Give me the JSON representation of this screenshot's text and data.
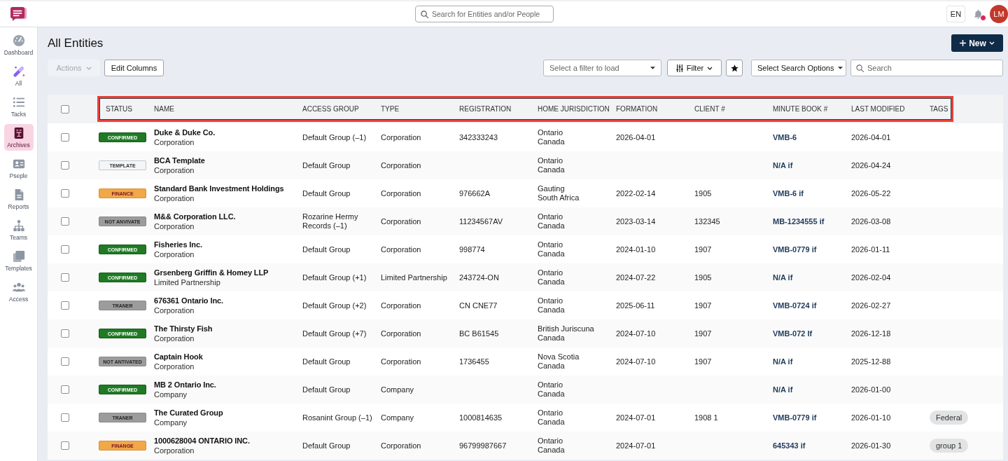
{
  "topbar": {
    "search": {
      "placeholder": "Search for Entities and/or People"
    },
    "language": "EN",
    "notifications": {
      "unread": true
    },
    "avatar": {
      "initials": "LM"
    }
  },
  "sidebar": {
    "items": [
      {
        "label": "Dashboard",
        "kind": "dashboard",
        "selected": false
      },
      {
        "label": "All",
        "kind": "all",
        "selected": false
      },
      {
        "label": "Tacks",
        "kind": "tasks",
        "selected": false
      },
      {
        "label": "Archives",
        "kind": "archives",
        "selected": true
      },
      {
        "label": "Pseple",
        "kind": "people",
        "selected": false
      },
      {
        "label": "Reports",
        "kind": "reports",
        "selected": false
      },
      {
        "label": "Teams",
        "kind": "teams",
        "selected": false
      },
      {
        "label": "Templates",
        "kind": "templates",
        "selected": false
      },
      {
        "label": "Access",
        "kind": "access",
        "selected": false
      }
    ]
  },
  "page": {
    "title": "All Entities",
    "new_button": {
      "label": "New"
    }
  },
  "toolbar": {
    "actions": {
      "label": "Actions",
      "disabled": true
    },
    "edit_columns": {
      "label": "Edit Columns"
    },
    "filter_select": {
      "placeholder": "Select a filter to load"
    },
    "filter_button": {
      "label": "Filter"
    },
    "search_options": {
      "label": "Select Search Options"
    },
    "search": {
      "placeholder": "Search"
    }
  },
  "table": {
    "header_highlighted": true,
    "header_checked": false,
    "columns": [
      "STATUS",
      "NAME",
      "ACCESS GROUP",
      "TYPE",
      "REGISTRATION",
      "HOME JURISDICTION",
      "FORMATION",
      "CLIENT #",
      "MINUTE BOOK #",
      "LAST MODIFIED",
      "TAGS"
    ],
    "rows": [
      {
        "checked": false,
        "status": {
          "label": "CONFIRMED",
          "kind": "confirmed"
        },
        "name": "Duke & Duke Co.",
        "entity_type": "Corporation",
        "access_group": "Default Group (–1)",
        "type": "Corporation",
        "registration": "342333243",
        "jurisdiction": {
          "region": "Ontario",
          "country": "Canada"
        },
        "formation": "2026-04-01",
        "minute_book": "VMB-6",
        "last_modified": "2026-04-01"
      },
      {
        "checked": false,
        "status": {
          "label": "TEMPLATE",
          "kind": "template"
        },
        "name": "BCA Template",
        "entity_type": "Corporation",
        "access_group": "Default Group",
        "type": "Corporation",
        "jurisdiction": {
          "region": "Ontario",
          "country": "Canada"
        },
        "minute_book": "N/A if",
        "last_modified": "2026-04-24"
      },
      {
        "checked": false,
        "status": {
          "label": "FINANCE",
          "kind": "finance"
        },
        "name": "Standard Bank Investment Holdings",
        "entity_type": "Corporation",
        "access_group": "Default Group",
        "type": "Corporation",
        "registration": "976662A",
        "jurisdiction": {
          "region": "Gauting",
          "country": "South Africa"
        },
        "formation": "2022-02-14",
        "client": "1905",
        "minute_book": "VMB-6 if",
        "last_modified": "2026-05-22"
      },
      {
        "checked": false,
        "status": {
          "label": "NOT ANVIVATE",
          "kind": "inactive"
        },
        "name": "M&& Corporation LLC.",
        "entity_type": "Corporation",
        "access_group": "Rozarine Hermy Records (–1)",
        "type": "Corporation",
        "registration": "11234567AV",
        "jurisdiction": {
          "region": "Ontario",
          "country": "Canada"
        },
        "formation": "2023-03-14",
        "client": "132345",
        "minute_book": "MB-1234555 if",
        "last_modified": "2026-03-08"
      },
      {
        "checked": false,
        "status": {
          "label": "CONFIRMED",
          "kind": "confirmed"
        },
        "name": "Fisheries Inc.",
        "entity_type": "Corporation",
        "access_group": "Default Group",
        "type": "Corporation",
        "registration": "998774",
        "jurisdiction": {
          "region": "Ontario",
          "country": "Canada"
        },
        "formation": "2024-01-10",
        "client": "1907",
        "minute_book": "VMB-0779 if",
        "last_modified": "2026-01-11"
      },
      {
        "checked": false,
        "status": {
          "label": "CONFIRMED",
          "kind": "confirmed"
        },
        "name": "Grsenberg Griffin & Homey LLP",
        "entity_type": "Limited Partnership",
        "access_group": "Default Group (+1)",
        "type": "Limited Partnership",
        "registration": "243724-ON",
        "jurisdiction": {
          "region": "Ontario",
          "country": "Canada"
        },
        "formation": "2024-07-22",
        "client": "1905",
        "minute_book": "N/A if",
        "last_modified": "2026-02-04"
      },
      {
        "checked": false,
        "status": {
          "label": "TRANER",
          "kind": "inactive"
        },
        "name": "676361 Ontario Inc.",
        "entity_type": "Corporation",
        "access_group": "Default Group (+2)",
        "type": "Corporation",
        "registration": "CN CNE77",
        "jurisdiction": {
          "region": "Ontario",
          "country": "Canada"
        },
        "formation": "2025-06-11",
        "client": "1907",
        "minute_book": "VMB-0724 if",
        "last_modified": "2026-02-27"
      },
      {
        "checked": false,
        "status": {
          "label": "CONFIRMED",
          "kind": "confirmed"
        },
        "name": "The Thirsty Fish",
        "entity_type": "Corporation",
        "access_group": "Default Group (+7)",
        "type": "Corporation",
        "registration": "BC B61545",
        "jurisdiction": {
          "region": "British Juriscuna",
          "country": "Canada"
        },
        "formation": "2024-07-10",
        "client": "1907",
        "minute_book": "VMB-072 If",
        "last_modified": "2026-12-18"
      },
      {
        "checked": false,
        "status": {
          "label": "NOT ANTIVATED",
          "kind": "inactive"
        },
        "name": "Captain Hook",
        "entity_type": "Corporation",
        "access_group": "Default Group",
        "type": "Corporation",
        "registration": "1736455",
        "jurisdiction": {
          "region": "Nova Scotia",
          "country": "Canada"
        },
        "formation": "2024-07-10",
        "client": "1907",
        "minute_book": "N/A if",
        "last_modified": "2025-12-88"
      },
      {
        "checked": false,
        "status": {
          "label": "CONFIRMED",
          "kind": "confirmed"
        },
        "name": "MB 2 Ontario Inc.",
        "entity_type": "Company",
        "access_group": "Default Group",
        "type": "Company",
        "jurisdiction": {
          "region": "Ontario",
          "country": "Canada"
        },
        "minute_book": "N/A if",
        "last_modified": "2026-01-00"
      },
      {
        "checked": false,
        "status": {
          "label": "TRANER",
          "kind": "inactive"
        },
        "name": "The Curated Group",
        "entity_type": "Company",
        "access_group": "Rosanint Group (–1)",
        "type": "Company",
        "registration": "1000814635",
        "jurisdiction": {
          "region": "Ontario",
          "country": "Canada"
        },
        "formation": "2024-07-01",
        "client": "1908 1",
        "minute_book": "VMB-0779 if",
        "last_modified": "2026-01-10",
        "tags": [
          "Federal"
        ]
      },
      {
        "checked": false,
        "status": {
          "label": "FINANGE",
          "kind": "finance"
        },
        "name": "1000628004 ONTARIO INC.",
        "entity_type": "Corporation",
        "access_group": "Default Group",
        "type": "Corporation",
        "registration": "96799987667",
        "jurisdiction": {
          "region": "Ontario",
          "country": "Canada"
        },
        "formation": "2024-07-01",
        "minute_book": "645343 if",
        "last_modified": "2026-01-30",
        "tags": [
          "group 1"
        ]
      }
    ]
  }
}
